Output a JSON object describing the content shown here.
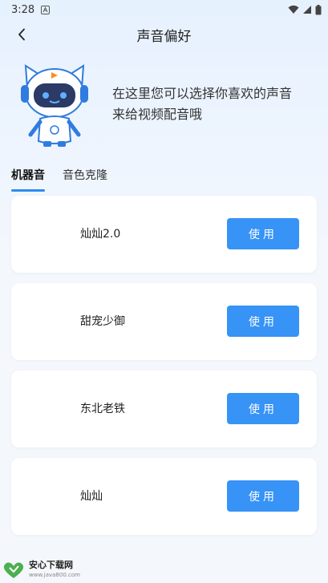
{
  "status_bar": {
    "time": "3:28",
    "notification_icon": "notification-a-icon",
    "icons": [
      "wifi-icon",
      "signal-icon",
      "battery-icon"
    ]
  },
  "nav": {
    "title": "声音偏好",
    "back_icon": "chevron-left-icon"
  },
  "hero": {
    "text_line1": "在这里您可以选择你喜欢的声音",
    "text_line2": "来给视频配音哦",
    "mascot_icon": "robot-cat-mascot"
  },
  "tabs": [
    {
      "label": "机器音",
      "active": true
    },
    {
      "label": "音色克隆",
      "active": false
    }
  ],
  "voices": [
    {
      "name": "灿灿2.0",
      "button": "使用"
    },
    {
      "name": "甜宠少御",
      "button": "使用"
    },
    {
      "name": "东北老铁",
      "button": "使用"
    },
    {
      "name": "灿灿",
      "button": "使用"
    }
  ],
  "watermark": {
    "title": "安心下载网",
    "url": "www.java800.com"
  },
  "colors": {
    "accent": "#3793f5",
    "tab_underline": "#2d8cf0",
    "background_top": "#e6f1fe",
    "card": "#ffffff"
  }
}
